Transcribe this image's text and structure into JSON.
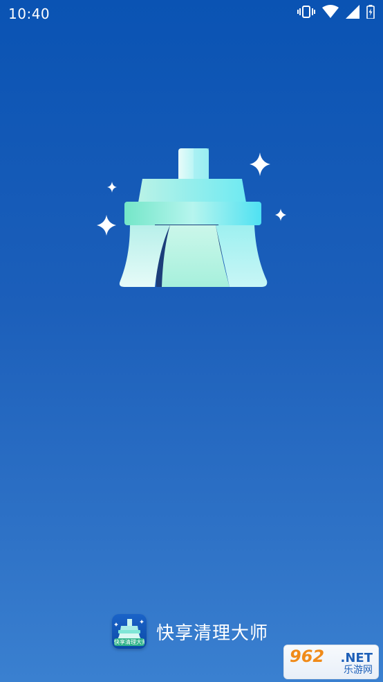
{
  "status_bar": {
    "time": "10:40",
    "icons": [
      "vibrate-icon",
      "wifi-icon",
      "signal-icon",
      "battery-charging-icon"
    ]
  },
  "splash": {
    "illustration": "broom-cleaning-icon",
    "sparkle_count": 4
  },
  "footer": {
    "app_icon_label": "快享清理大师",
    "app_name": "快享清理大师"
  },
  "watermark": {
    "number": "962",
    "net": ".NET",
    "sub": "乐游网"
  },
  "colors": {
    "background_top": "#0a53b3",
    "background_bottom": "#3a80d0",
    "broom_light": "#c6f4ee",
    "broom_cyan": "#5ee8f0",
    "watermark_orange": "#f08b1a"
  }
}
